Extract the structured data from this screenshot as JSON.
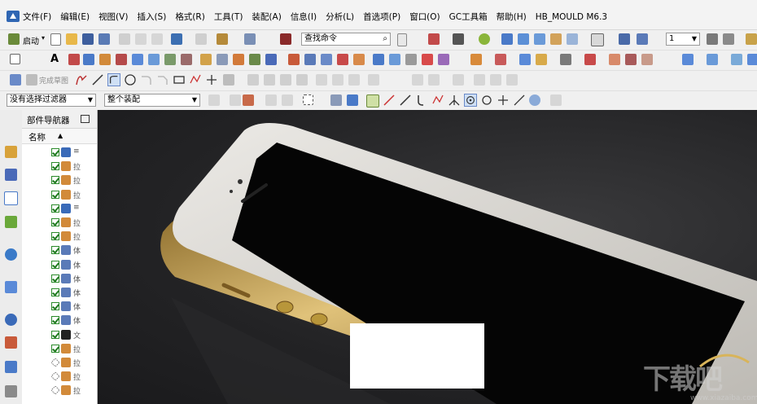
{
  "menubar": {
    "items": [
      "文件(F)",
      "编辑(E)",
      "视图(V)",
      "插入(S)",
      "格式(R)",
      "工具(T)",
      "装配(A)",
      "信息(I)",
      "分析(L)",
      "首选项(P)",
      "窗口(O)",
      "GC工具箱",
      "帮助(H)",
      "HB_MOULD M6.3"
    ]
  },
  "toolbar1": {
    "start_label": "启动",
    "command_search_value": "查找命令",
    "layer_value": "1"
  },
  "toolbar3": {
    "finish_sketch_label": "完成草图"
  },
  "selection_bar": {
    "filter_value": "没有选择过滤器",
    "scope_value": "整个装配"
  },
  "navigator": {
    "title": "部件导航器",
    "column_name": "名称",
    "rows": [
      {
        "icon": "assembly-constraint-icon",
        "text": "≡",
        "checked": true
      },
      {
        "icon": "extrude-feature-icon",
        "text": "拉",
        "checked": true
      },
      {
        "icon": "extrude-feature-icon",
        "text": "拉",
        "checked": true
      },
      {
        "icon": "extrude-feature-icon",
        "text": "拉",
        "checked": true
      },
      {
        "icon": "assembly-constraint-icon",
        "text": "≡",
        "checked": true
      },
      {
        "icon": "extrude-feature-icon",
        "text": "拉",
        "checked": true
      },
      {
        "icon": "extrude-feature-icon",
        "text": "拉",
        "checked": true
      },
      {
        "icon": "body-feature-icon",
        "text": "体",
        "checked": true
      },
      {
        "icon": "body-feature-icon",
        "text": "体",
        "checked": true
      },
      {
        "icon": "body-feature-icon",
        "text": "体",
        "checked": true
      },
      {
        "icon": "body-feature-icon",
        "text": "体",
        "checked": true
      },
      {
        "icon": "body-feature-icon",
        "text": "体",
        "checked": true
      },
      {
        "icon": "body-feature-icon",
        "text": "体",
        "checked": true
      },
      {
        "icon": "text-feature-icon",
        "text": "文",
        "checked": true
      },
      {
        "icon": "extrude-feature-icon",
        "text": "拉",
        "checked": true
      },
      {
        "icon": "extrude-feature-icon",
        "text": "拉",
        "checked": false
      },
      {
        "icon": "extrude-feature-icon",
        "text": "拉",
        "checked": false
      },
      {
        "icon": "extrude-feature-icon",
        "text": "拉",
        "checked": false
      }
    ]
  },
  "watermark": {
    "text": "下载吧",
    "url": "www.xiazaiba.com"
  },
  "colors": {
    "check_green": "#1e7a1e",
    "phone_gold": "#c9a24a",
    "phone_silver": "#d9d7d2",
    "screen_black": "#050505"
  }
}
